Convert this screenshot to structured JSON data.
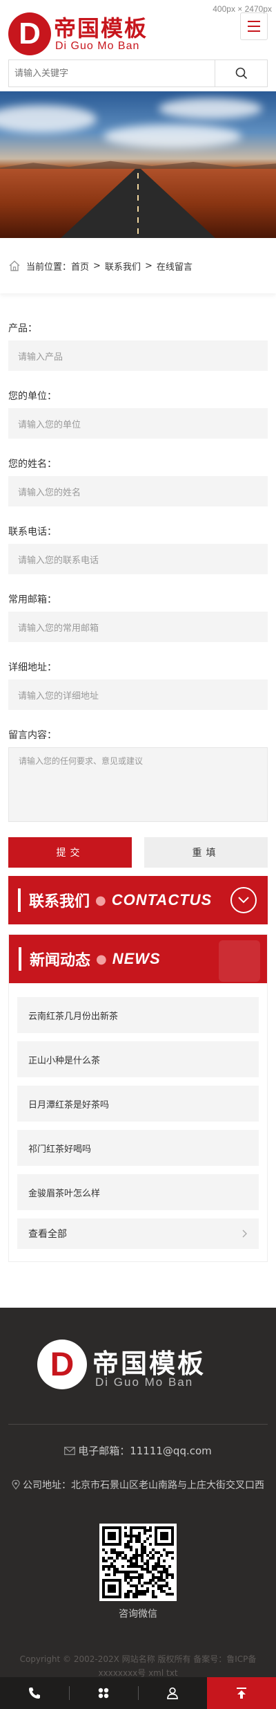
{
  "meta": {
    "dimensions": "400px × 2470px"
  },
  "header": {
    "logo_letter": "D",
    "logo_cn": "帝国模板",
    "logo_en": "Di Guo Mo Ban"
  },
  "search": {
    "placeholder": "请输入关键字"
  },
  "breadcrumb": {
    "prefix": "当前位置：",
    "home": "首页",
    "sep": ">",
    "level1": "联系我们",
    "level2": "在线留言"
  },
  "form": {
    "fields": [
      {
        "label": "产品：",
        "placeholder": "请输入产品"
      },
      {
        "label": "您的单位：",
        "placeholder": "请输入您的单位"
      },
      {
        "label": "您的姓名：",
        "placeholder": "请输入您的姓名"
      },
      {
        "label": "联系电话：",
        "placeholder": "请输入您的联系电话"
      },
      {
        "label": "常用邮箱：",
        "placeholder": "请输入您的常用邮箱"
      },
      {
        "label": "详细地址：",
        "placeholder": "请输入您的详细地址"
      },
      {
        "label": "留言内容：",
        "placeholder": "请输入您的任何要求、意见或建议"
      }
    ],
    "submit_label": "提交",
    "reset_label": "重填"
  },
  "contact_bar": {
    "cn": "联系我们",
    "dot": "●",
    "en": "CONTACTUS"
  },
  "news": {
    "cn": "新闻动态",
    "dot": "●",
    "en": "NEWS",
    "items": [
      "云南红茶几月份出新茶",
      "正山小种是什么茶",
      "日月潭红茶是好茶吗",
      "祁门红茶好喝吗",
      "金骏眉茶叶怎么样"
    ],
    "view_all": "查看全部"
  },
  "footer": {
    "logo_letter": "D",
    "logo_cn": "帝国模板",
    "logo_en": "Di Guo Mo Ban",
    "email": "电子邮箱：11111@qq.com",
    "address": "公司地址：北京市石景山区老山南路与上庄大街交叉口西",
    "qr_label": "咨询微信",
    "copyright": "Copyright © 2002-202X 网站名称 版权所有 备案号：鲁ICP备xxxxxxxx号 xml txt"
  },
  "tabbar": {
    "items": [
      "phone-icon",
      "grid-icon",
      "user-icon",
      "top-icon"
    ]
  },
  "colors": {
    "brand": "#c7161d",
    "footer_bg": "#2c2a29"
  }
}
